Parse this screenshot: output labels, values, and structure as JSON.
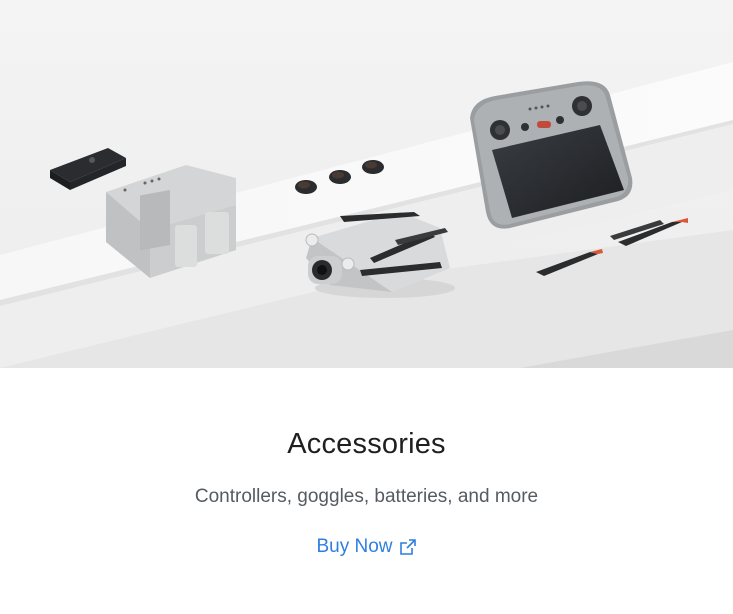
{
  "card": {
    "title": "Accessories",
    "subtitle": "Controllers, goggles, batteries, and more",
    "cta_label": "Buy Now",
    "cta_icon": "external-link-icon"
  },
  "colors": {
    "title": "#1f1f1f",
    "subtitle": "#555b61",
    "link": "#2f7fe0",
    "hero_background": "#f2f2f2"
  }
}
